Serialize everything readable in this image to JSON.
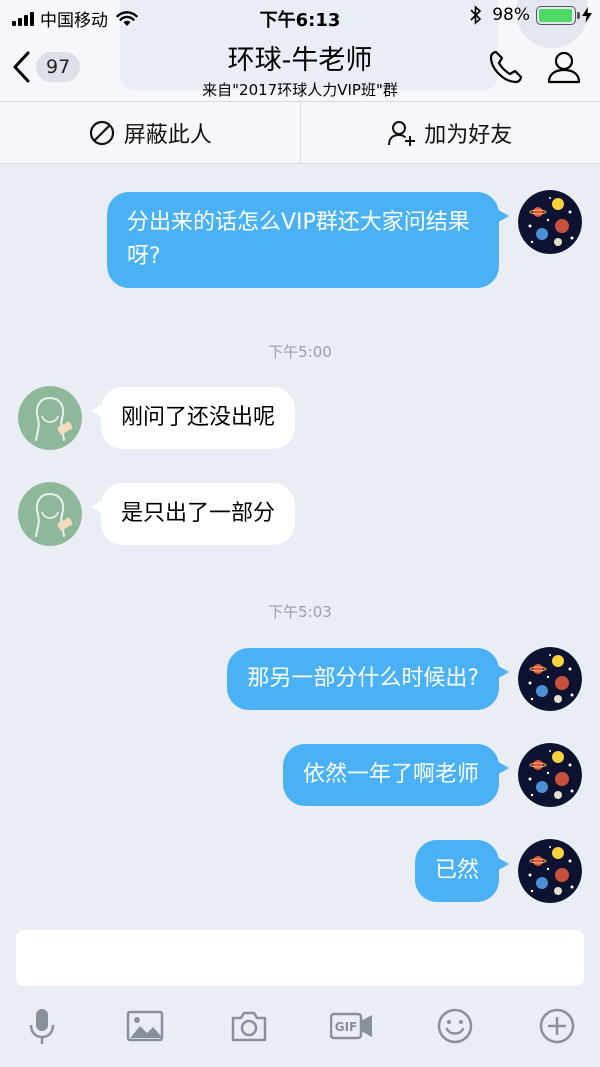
{
  "status_bar": {
    "carrier": "中国移动",
    "time": "下午6:13",
    "battery_percent": "98%",
    "battery_level": 0.98
  },
  "header": {
    "back_count": "97",
    "title": "环球-牛老师",
    "subtitle": "来自\"2017环球人力VIP班\"群",
    "icons": [
      "chevron-left-icon",
      "phone-icon",
      "profile-icon"
    ]
  },
  "actions": {
    "block_label": "屏蔽此人",
    "add_friend_label": "加为好友"
  },
  "messages": [
    {
      "type": "message",
      "side": "out",
      "text": "分出来的话怎么VIP群还大家问结果呀?"
    },
    {
      "type": "time",
      "text": "下午5:00"
    },
    {
      "type": "message",
      "side": "in",
      "text": "刚问了还没出呢"
    },
    {
      "type": "message",
      "side": "in",
      "text": "是只出了一部分"
    },
    {
      "type": "time",
      "text": "下午5:03"
    },
    {
      "type": "message",
      "side": "out",
      "text": "那另一部分什么时候出?"
    },
    {
      "type": "message",
      "side": "out",
      "text": "依然一年了啊老师"
    },
    {
      "type": "message",
      "side": "out",
      "text": "已然"
    }
  ],
  "input": {
    "value": "",
    "placeholder": ""
  },
  "toolbar": {
    "icons": [
      "microphone-icon",
      "image-icon",
      "camera-icon",
      "gif-icon",
      "emoji-icon",
      "plus-icon"
    ],
    "gif_text": "GIF"
  },
  "colors": {
    "outgoing_bubble": "#4ab2f4",
    "incoming_bubble": "#ffffff",
    "background": "#ebedf5",
    "battery": "#4cd964"
  }
}
